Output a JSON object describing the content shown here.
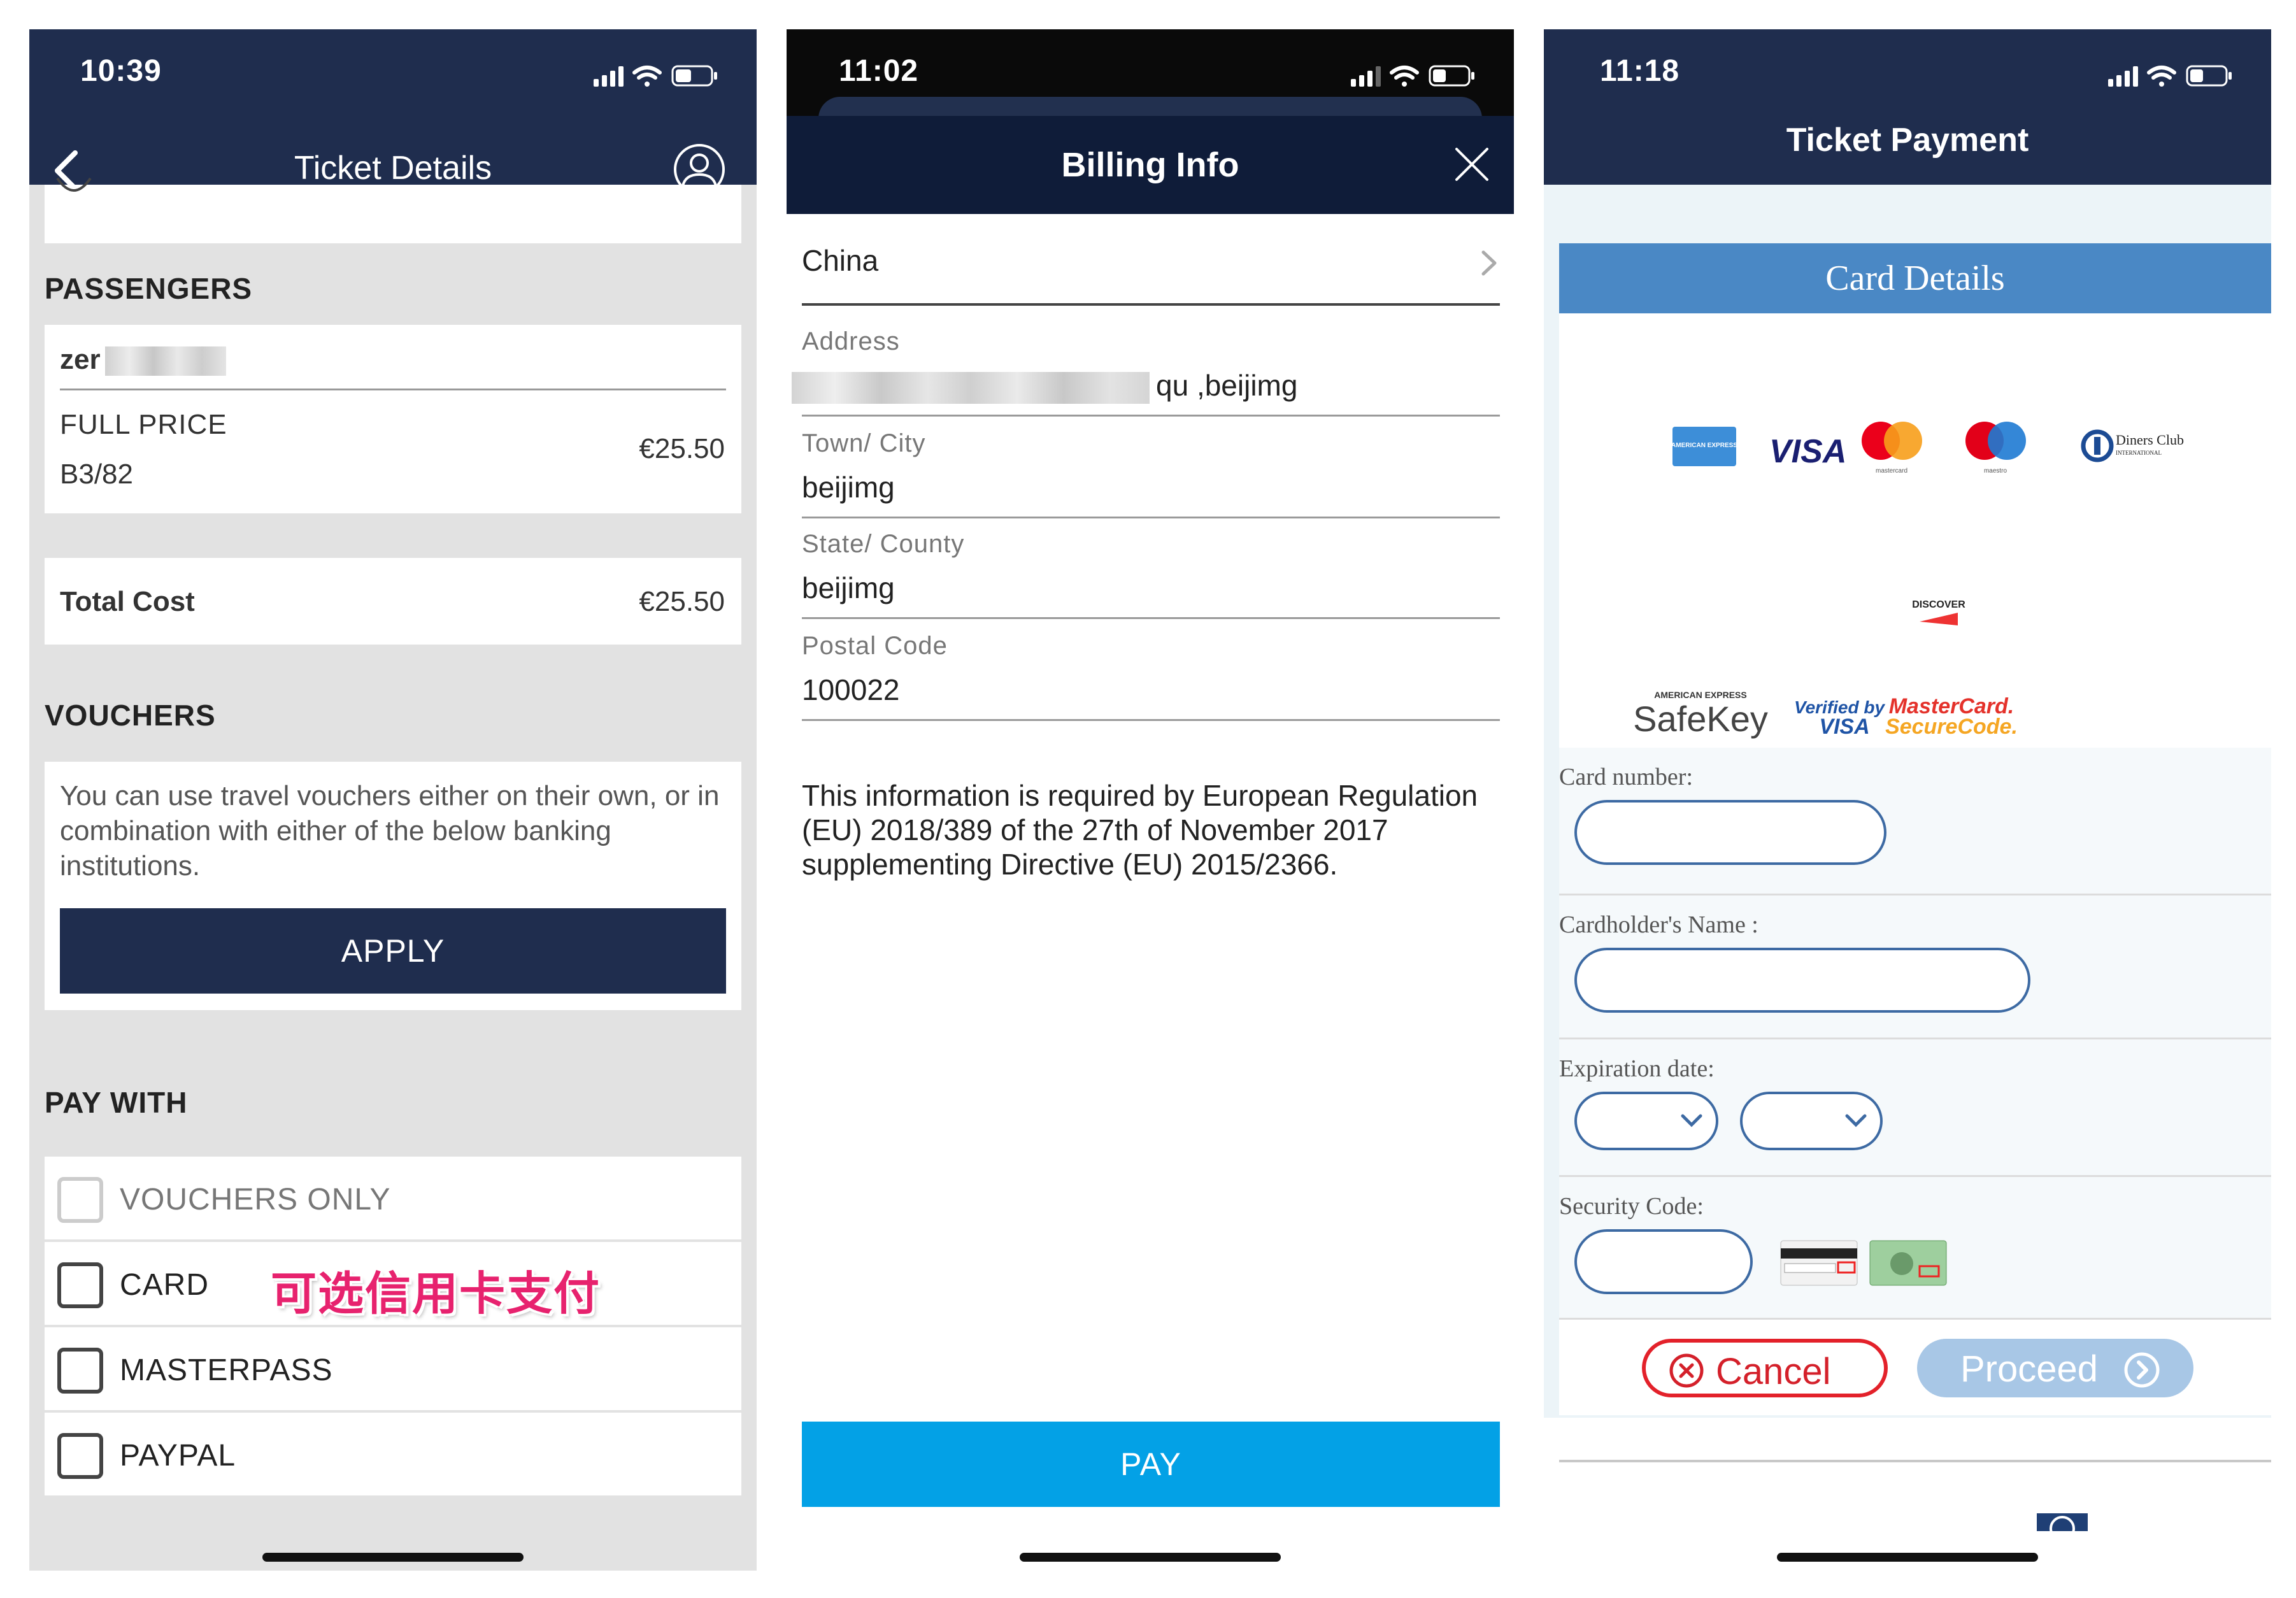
{
  "phone1": {
    "status_time": "10:39",
    "title": "Ticket Details",
    "passengers_heading": "PASSENGERS",
    "passenger_name": "zer",
    "fare_type": "FULL PRICE",
    "seat": "B3/82",
    "fare_price": "€25.50",
    "total_label": "Total Cost",
    "total_price": "€25.50",
    "vouchers_heading": "VOUCHERS",
    "vouchers_text": "You can use travel vouchers either on their own, or in combination with either of the below banking institutions.",
    "apply_label": "APPLY",
    "pay_with_heading": "PAY WITH",
    "pay_options": [
      {
        "label": "VOUCHERS ONLY",
        "checked": false,
        "enabled": false
      },
      {
        "label": "CARD",
        "checked": false,
        "enabled": true
      },
      {
        "label": "MASTERPASS",
        "checked": false,
        "enabled": true
      },
      {
        "label": "PAYPAL",
        "checked": false,
        "enabled": true
      }
    ],
    "card_annotation": "可选信用卡支付"
  },
  "phone2": {
    "status_time": "11:02",
    "title": "Billing Info",
    "country": "China",
    "fields": [
      {
        "label": "Address",
        "value": "qu ,beijimg"
      },
      {
        "label": "Town/ City",
        "value": "beijimg"
      },
      {
        "label": "State/ County",
        "value": "beijimg"
      },
      {
        "label": "Postal Code",
        "value": "100022"
      }
    ],
    "regulation_text": "This information is required by European Regulation (EU) 2018/389 of the 27th of November 2017 supplementing Directive (EU) 2015/2366.",
    "pay_label": "PAY"
  },
  "phone3": {
    "status_time": "11:18",
    "title": "Ticket Payment",
    "card_details_label": "Card Details",
    "card_logos": [
      "American Express",
      "VISA",
      "mastercard",
      "maestro",
      "Diners Club International",
      "DISCOVER"
    ],
    "logo_texts": {
      "amex": "AMERICAN EXPRESS",
      "visa": "VISA",
      "mastercard": "mastercard",
      "maestro": "maestro",
      "diners": "Diners Club",
      "diners_sub": "INTERNATIONAL",
      "discover": "DISCOVER"
    },
    "secure_logos": {
      "safekey_top": "AMERICAN EXPRESS",
      "safekey": "SafeKey",
      "verified_by": "Verified by",
      "verified_visa": "VISA",
      "mc_secure_top": "MasterCard.",
      "mc_secure_bottom": "SecureCode."
    },
    "card_number_label": "Card number:",
    "cardholder_label": "Cardholder's Name :",
    "expiration_label": "Expiration date:",
    "security_label": "Security Code:",
    "cancel_label": "Cancel",
    "proceed_label": "Proceed"
  },
  "colors": {
    "navy": "#1f2d4e",
    "dark_navy": "#0f1c39",
    "pay_blue": "#03a1e6",
    "card_details_blue": "#4a88c5",
    "cancel_red": "#e3212a",
    "proceed_disabled": "#a8c7e6",
    "annotation_pink": "#e7226e"
  }
}
